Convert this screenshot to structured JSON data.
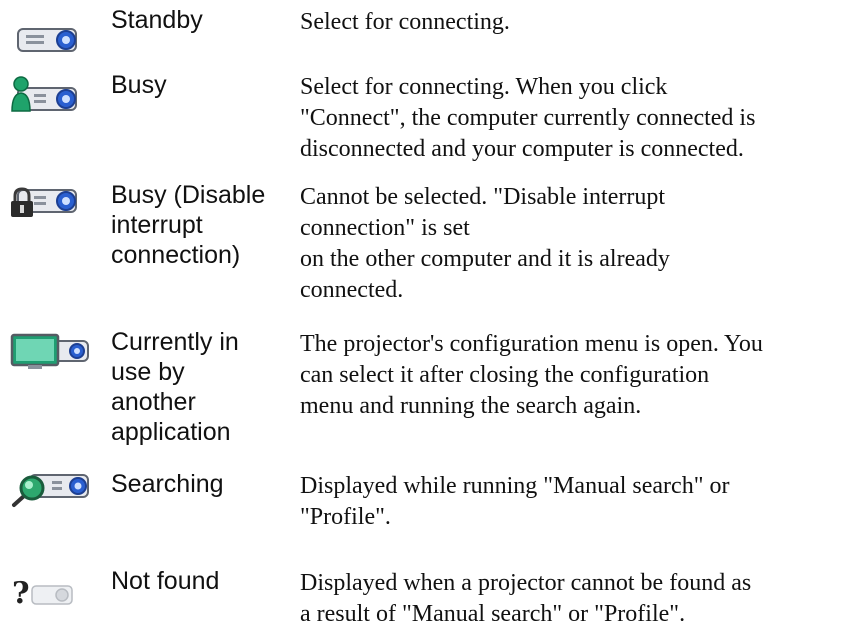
{
  "states": [
    {
      "icon": "projector-standby-icon",
      "name": [
        "Standby"
      ],
      "desc": [
        "Select for connecting."
      ]
    },
    {
      "icon": "projector-busy-icon",
      "name": [
        "Busy"
      ],
      "desc": [
        "Select for connecting. When you click",
        "\"Connect\", the computer currently connected is",
        "disconnected and your computer is connected."
      ]
    },
    {
      "icon": "projector-locked-icon",
      "name": [
        "Busy (Disable",
        "interrupt",
        "connection)"
      ],
      "desc": [
        "Cannot be selected. \"Disable interrupt",
        "connection\" is set",
        "on the other computer and it is already",
        "connected."
      ]
    },
    {
      "icon": "projector-in-use-icon",
      "name": [
        "Currently in",
        "use by",
        "another",
        "application"
      ],
      "desc": [
        "The projector's configuration menu is open. You",
        "can select it after closing the configuration",
        "menu and running the search again."
      ]
    },
    {
      "icon": "projector-searching-icon",
      "name": [
        "Searching"
      ],
      "desc": [
        "Displayed while running \"Manual search\" or",
        "\"Profile\"."
      ]
    },
    {
      "icon": "projector-not-found-icon",
      "name": [
        "Not found"
      ],
      "desc": [
        "Displayed when a projector cannot be found as",
        "a result of \"Manual search\" or \"Profile\"."
      ]
    }
  ]
}
